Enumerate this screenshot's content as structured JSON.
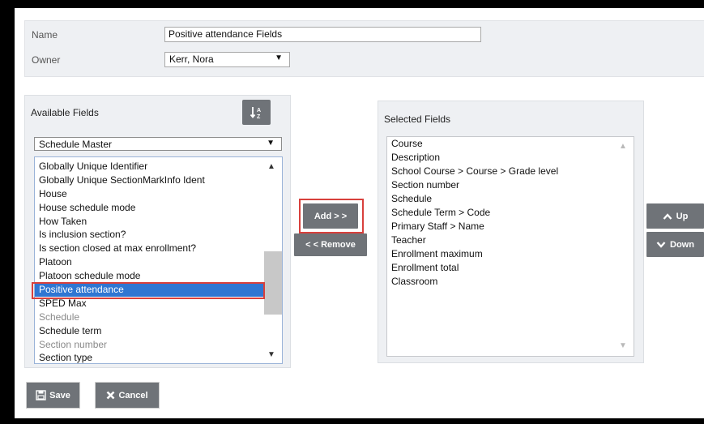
{
  "form": {
    "name_label": "Name",
    "name_value": "Positive attendance Fields",
    "owner_label": "Owner",
    "owner_value": "Kerr, Nora"
  },
  "available": {
    "title": "Available Fields",
    "table_select": "Schedule Master",
    "items": [
      {
        "label": "Globally Unique Identifier",
        "state": "normal"
      },
      {
        "label": "Globally Unique SectionMarkInfo Ident",
        "state": "normal"
      },
      {
        "label": "House",
        "state": "normal"
      },
      {
        "label": "House schedule mode",
        "state": "normal"
      },
      {
        "label": "How Taken",
        "state": "normal"
      },
      {
        "label": "Is inclusion section?",
        "state": "normal"
      },
      {
        "label": "Is section closed at max enrollment?",
        "state": "normal"
      },
      {
        "label": "Platoon",
        "state": "normal"
      },
      {
        "label": "Platoon schedule mode",
        "state": "normal"
      },
      {
        "label": "Positive attendance",
        "state": "selected"
      },
      {
        "label": "SPED Max",
        "state": "normal"
      },
      {
        "label": "Schedule",
        "state": "dim"
      },
      {
        "label": "Schedule term",
        "state": "normal"
      },
      {
        "label": "Section number",
        "state": "dim"
      },
      {
        "label": "Section type",
        "state": "normal"
      }
    ]
  },
  "actions": {
    "add_label": "Add > >",
    "remove_label": "< < Remove",
    "up_label": "Up",
    "down_label": "Down",
    "save_label": "Save",
    "cancel_label": "Cancel"
  },
  "selected": {
    "title": "Selected Fields",
    "items": [
      "Course",
      "Description",
      "School Course > Course > Grade level",
      "Section number",
      "Schedule",
      "Schedule Term > Code",
      "Primary Staff > Name",
      "Teacher",
      "Enrollment maximum",
      "Enrollment total",
      "Classroom"
    ]
  },
  "colors": {
    "selection": "#2f76d2",
    "highlight_border": "#d8403c",
    "button": "#6f7378"
  },
  "icons": {
    "sort": "sort-alpha-icon",
    "up": "chevron-up-icon",
    "down": "chevron-down-icon",
    "save": "save-disk-icon",
    "cancel": "x-cancel-icon"
  }
}
